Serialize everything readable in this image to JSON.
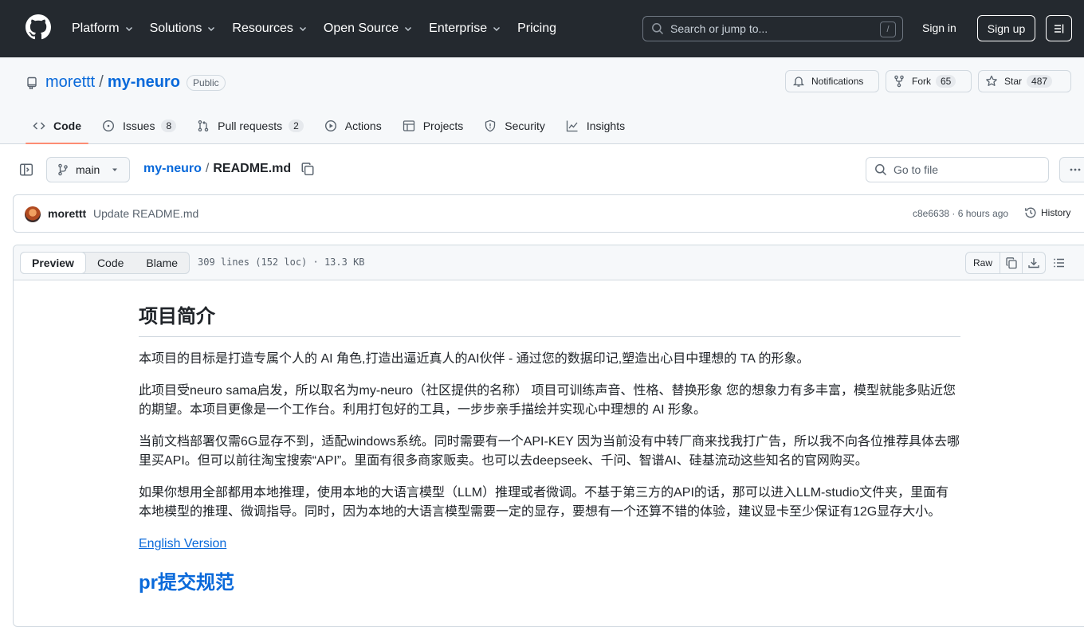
{
  "header": {
    "nav": [
      {
        "label": "Platform",
        "has_menu": true
      },
      {
        "label": "Solutions",
        "has_menu": true
      },
      {
        "label": "Resources",
        "has_menu": true
      },
      {
        "label": "Open Source",
        "has_menu": true
      },
      {
        "label": "Enterprise",
        "has_menu": true
      },
      {
        "label": "Pricing",
        "has_menu": false
      }
    ],
    "search_placeholder": "Search or jump to...",
    "search_shortcut": "/",
    "signin": "Sign in",
    "signup": "Sign up"
  },
  "repo": {
    "owner": "morettt",
    "separator": "/",
    "name": "my-neuro",
    "visibility": "Public",
    "notifications_label": "Notifications",
    "fork_label": "Fork",
    "fork_count": "65",
    "star_label": "Star",
    "star_count": "487",
    "tabs": [
      {
        "label": "Code",
        "icon": "code-icon",
        "active": true,
        "count": ""
      },
      {
        "label": "Issues",
        "icon": "issue-icon",
        "active": false,
        "count": "8"
      },
      {
        "label": "Pull requests",
        "icon": "pull-request-icon",
        "active": false,
        "count": "2"
      },
      {
        "label": "Actions",
        "icon": "play-icon",
        "active": false,
        "count": ""
      },
      {
        "label": "Projects",
        "icon": "table-icon",
        "active": false,
        "count": ""
      },
      {
        "label": "Security",
        "icon": "shield-icon",
        "active": false,
        "count": ""
      },
      {
        "label": "Insights",
        "icon": "graph-icon",
        "active": false,
        "count": ""
      }
    ]
  },
  "filebar": {
    "branch": "main",
    "breadcrumb_repo": "my-neuro",
    "breadcrumb_sep": "/",
    "breadcrumb_file": "README.md",
    "goto_placeholder": "Go to file"
  },
  "commit": {
    "author": "morettt",
    "message": "Update README.md",
    "meta": "c8e6638 · 6 hours ago",
    "history": "History"
  },
  "fileview": {
    "modes": [
      "Preview",
      "Code",
      "Blame"
    ],
    "active_mode": "Preview",
    "info": "309 lines (152 loc) · 13.3 KB",
    "raw": "Raw"
  },
  "readme": {
    "heading": "项目简介",
    "paragraphs": [
      "本项目的目标是打造专属个人的 AI 角色,打造出逼近真人的AI伙伴 - 通过您的数据印记,塑造出心目中理想的 TA 的形象。",
      "此项目受neuro sama启发，所以取名为my-neuro（社区提供的名称） 项目可训练声音、性格、替换形象 您的想象力有多丰富，模型就能多贴近您的期望。本项目更像是一个工作台。利用打包好的工具，一步步亲手描绘并实现心中理想的 AI 形象。",
      "当前文档部署仅需6G显存不到，适配windows系统。同时需要有一个API-KEY 因为当前没有中转厂商来找我打广告，所以我不向各位推荐具体去哪里买API。但可以前往淘宝搜索“API”。里面有很多商家贩卖。也可以去deepseek、千问、智谱AI、硅基流动这些知名的官网购买。",
      "如果你想用全部都用本地推理，使用本地的大语言模型（LLM）推理或者微调。不基于第三方的API的话，那可以进入LLM-studio文件夹，里面有本地模型的推理、微调指导。同时，因为本地的大语言模型需要一定的显存，要想有一个还算不错的体验，建议显卡至少保证有12G显存大小。"
    ],
    "english_link": "English Version",
    "next_heading": "pr提交规范"
  }
}
